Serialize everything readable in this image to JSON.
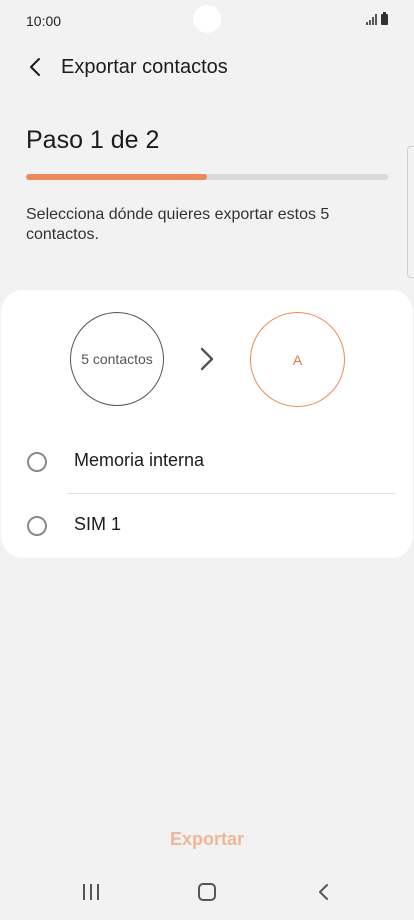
{
  "status_bar": {
    "time": "10:00",
    "icons": [
      "signal-icon",
      "battery-icon"
    ]
  },
  "header": {
    "back_icon": "chevron-left-icon",
    "title": "Exportar contactos"
  },
  "step": {
    "title": "Paso 1 de 2",
    "progress": 0.5
  },
  "description": "Selecciona dónde quieres exportar estos 5 contactos.",
  "transfer": {
    "source_label": "5 contactos",
    "arrow_icon": "chevron-right-icon",
    "target_label": "A"
  },
  "options": [
    {
      "label": "Memoria interna",
      "selected": false
    },
    {
      "label": "SIM 1",
      "selected": false
    }
  ],
  "footer": {
    "export_label": "Exportar"
  },
  "nav": {
    "recents_icon": "recents-icon",
    "home_icon": "home-icon",
    "back_icon": "back-icon"
  },
  "colors": {
    "accent": "#ec8a5b",
    "accent_disabled": "#f0b699",
    "background": "#f2f2f2",
    "card": "#ffffff"
  }
}
